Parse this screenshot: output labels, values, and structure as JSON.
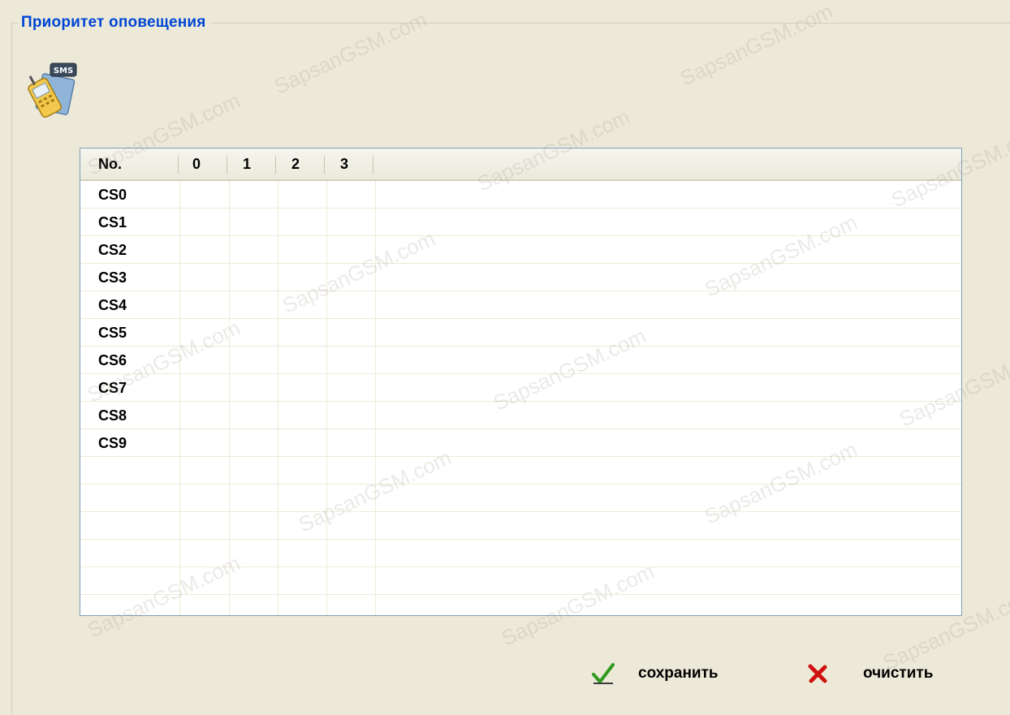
{
  "group": {
    "title": "Приоритет оповещения"
  },
  "icon": {
    "name": "sms-phone-icon",
    "badge": "SMS"
  },
  "grid": {
    "columns": [
      "No.",
      "0",
      "1",
      "2",
      "3"
    ],
    "rows": [
      {
        "label": "CS0"
      },
      {
        "label": "CS1"
      },
      {
        "label": "CS2"
      },
      {
        "label": "CS3"
      },
      {
        "label": "CS4"
      },
      {
        "label": "CS5"
      },
      {
        "label": "CS6"
      },
      {
        "label": "CS7"
      },
      {
        "label": "CS8"
      },
      {
        "label": "CS9"
      },
      {
        "label": ""
      },
      {
        "label": ""
      },
      {
        "label": ""
      },
      {
        "label": ""
      },
      {
        "label": ""
      }
    ]
  },
  "buttons": {
    "save_label": "сохранить",
    "clear_label": "очистить",
    "save_icon": "checkmark-icon",
    "clear_icon": "cross-icon"
  },
  "watermark": "SapsanGSM.com",
  "colors": {
    "title": "#0046D5",
    "background": "#ECE9D8",
    "grid_border": "#7F9DB9",
    "check": "#2E9A1E",
    "cross": "#D01010"
  }
}
